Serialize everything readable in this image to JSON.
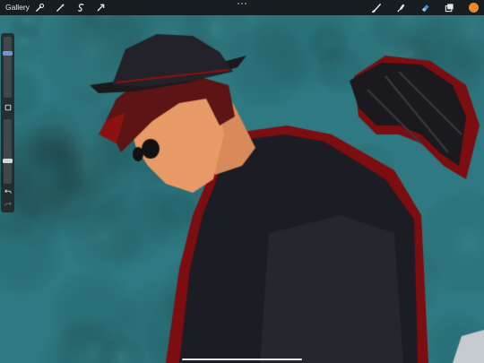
{
  "toolbar": {
    "gallery_label": "Gallery",
    "left_tools": [
      "wrench-icon",
      "magic-wand-icon",
      "selection-icon",
      "transform-arrow-icon"
    ],
    "right_tools": [
      "brush-icon",
      "smudge-icon",
      "eraser-icon",
      "layers-icon"
    ],
    "active_tool": "eraser-icon",
    "current_color": "#f08a24"
  },
  "sidebar": {
    "brush_size_level": 0.75,
    "brush_opacity_level": 0.35,
    "controls": [
      "modify-square-icon",
      "undo-icon",
      "redo-icon"
    ]
  },
  "colors": {
    "background_teal": "#2f7a82",
    "accent_blue": "#3a8de0",
    "toolbar_bg": "#161618"
  }
}
